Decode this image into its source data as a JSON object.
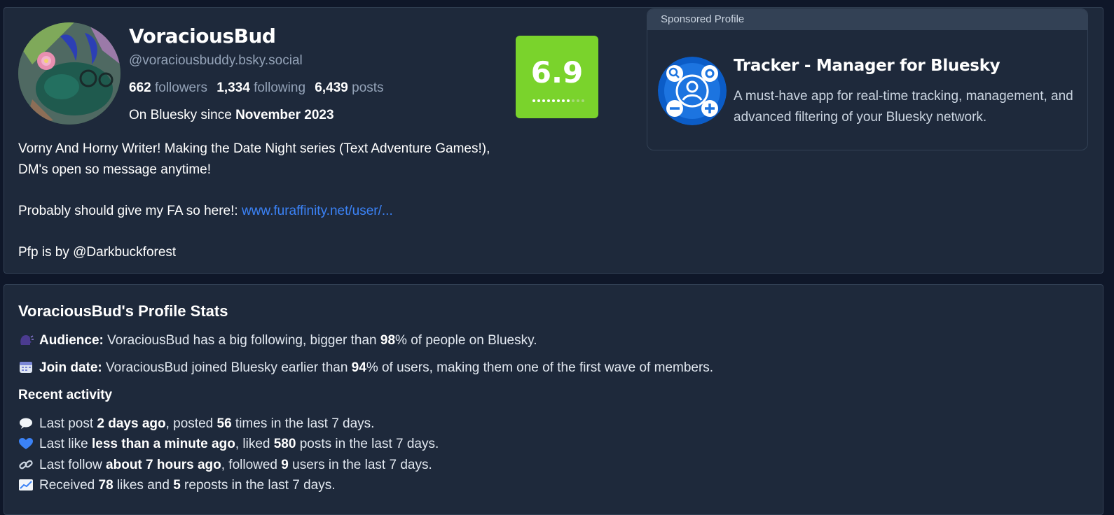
{
  "profile": {
    "display_name": "VoraciousBud",
    "handle": "@voraciousbuddy.bsky.social",
    "followers_count": "662",
    "followers_label": "followers",
    "following_count": "1,334",
    "following_label": "following",
    "posts_count": "6,439",
    "posts_label": "posts",
    "since_prefix": "On Bluesky since",
    "since_date": "November 2023",
    "score": "6.9",
    "score_level_dots_filled": 8,
    "score_level_dots_total": 11,
    "score_color": "#7ad32c",
    "bio": {
      "line1": "Vorny And Horny Writer! Making the Date Night series (Text Adventure Games!),",
      "line2": "DM's open so message anytime!",
      "line3_prefix": "Probably should give my FA so here!: ",
      "line3_link": "www.furaffinity.net/user/...",
      "line4": "Pfp is by @Darkbuckforest"
    }
  },
  "sponsor": {
    "header": "Sponsored Profile",
    "title": "Tracker - Manager for Bluesky",
    "description": "A must-have app for real-time tracking, management, and advanced filtering of your Bluesky network."
  },
  "stats": {
    "title": "VoraciousBud's Profile Stats",
    "audience_label": "Audience:",
    "audience_text1": " VoraciousBud has a big following, bigger than ",
    "audience_pct": "98",
    "audience_text2": "% of people on Bluesky.",
    "join_label": "Join date:",
    "join_text1": " VoraciousBud joined Bluesky earlier than ",
    "join_pct": "94",
    "join_text2": "% of users, making them one of the first wave of members.",
    "recent_title": "Recent activity",
    "post_text1": "Last post ",
    "post_when": "2 days ago",
    "post_text2": ", posted ",
    "post_count": "56",
    "post_text3": " times in the last 7 days.",
    "like_text1": "Last like ",
    "like_when": "less than a minute ago",
    "like_text2": ", liked ",
    "like_count": "580",
    "like_text3": " posts in the last 7 days.",
    "follow_text1": "Last follow ",
    "follow_when": "about 7 hours ago",
    "follow_text2": ", followed ",
    "follow_count": "9",
    "follow_text3": " users in the last 7 days.",
    "received_text1": "Received ",
    "received_likes": "78",
    "received_text2": " likes and ",
    "received_reposts": "5",
    "received_text3": " reposts in the last 7 days."
  },
  "icons": {
    "audience": "speaking-head-icon",
    "join": "calendar-icon",
    "post": "speech-bubble-icon",
    "like": "blue-heart-icon",
    "follow": "link-icon",
    "received": "chart-increasing-icon"
  }
}
